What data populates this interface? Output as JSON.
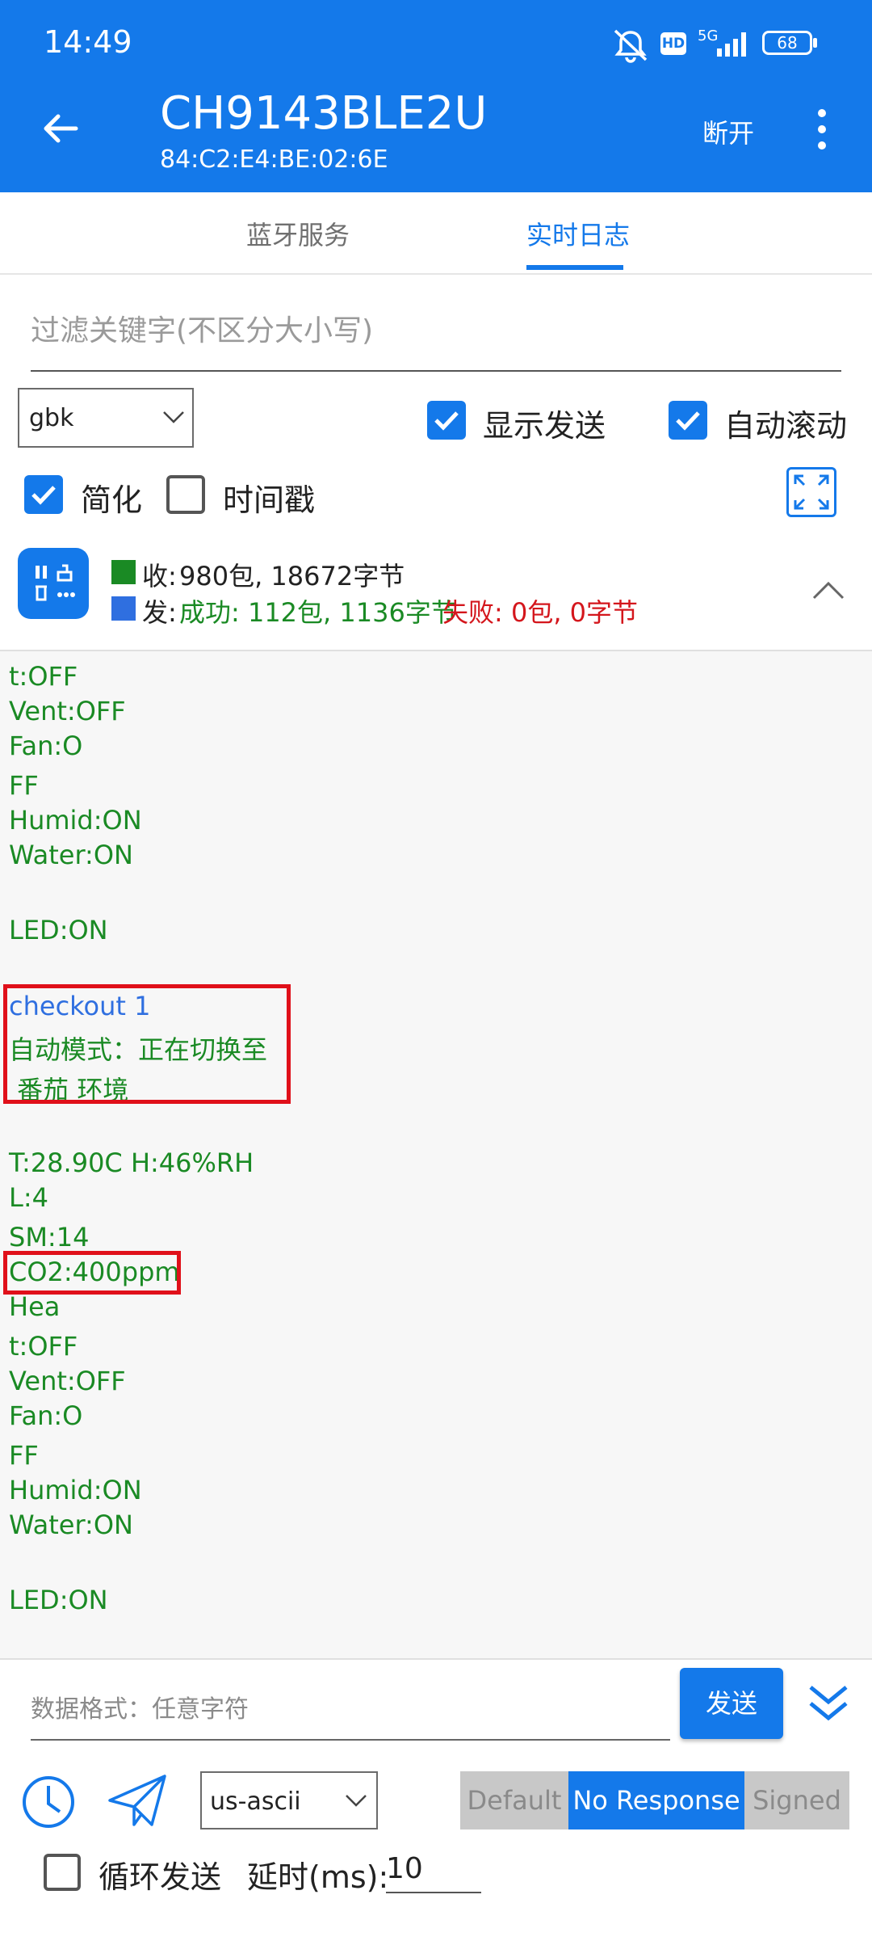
{
  "status_bar": {
    "time": "14:49",
    "network": "5G",
    "hd": "HD",
    "battery": "68"
  },
  "header": {
    "title": "CH9143BLE2U",
    "subtitle": "84:C2:E4:BE:02:6E",
    "disconnect_label": "断开"
  },
  "tabs": [
    {
      "label": "蓝牙服务",
      "active": false
    },
    {
      "label": "实时日志",
      "active": true
    }
  ],
  "filter": {
    "placeholder": "过滤关键字(不区分大小写)"
  },
  "options": {
    "charset": "gbk",
    "show_send": {
      "label": "显示发送",
      "checked": true
    },
    "auto_scroll": {
      "label": "自动滚动",
      "checked": true
    },
    "simplify": {
      "label": "简化",
      "checked": true
    },
    "timestamp": {
      "label": "时间戳",
      "checked": false
    }
  },
  "stats": {
    "recv_prefix": "收:",
    "recv_text": "980包, 18672字节",
    "send_prefix": "发:",
    "success_text": "成功: 112包, 1136字节",
    "fail_text": "失败: 0包, 0字节"
  },
  "log_lines": [
    "t:OFF",
    "Vent:OFF",
    "Fan:O",
    "FF",
    "Humid:ON",
    "Water:ON",
    "LED:ON",
    "checkout 1",
    "自动模式：正在切换至",
    " 番茄 环境",
    "T:28.90C H:46%RH",
    "L:4",
    "SM:14",
    "CO2:400ppm",
    "Hea",
    "t:OFF",
    "Vent:OFF",
    "Fan:O",
    "FF",
    "Humid:ON",
    "Water:ON",
    "LED:ON"
  ],
  "send": {
    "placeholder": "数据格式：任意字符",
    "button": "发送",
    "encoding": "us-ascii"
  },
  "write_types": [
    {
      "label": "Default",
      "selected": false
    },
    {
      "label": "No Response",
      "selected": true
    },
    {
      "label": "Signed",
      "selected": false
    }
  ],
  "loop": {
    "label": "循环发送",
    "checked": false,
    "delay_label": "延时(ms):",
    "delay_value": "10"
  },
  "colors": {
    "primary": "#1479ea",
    "log_green": "#1a8a24",
    "log_blue": "#2f6fe0",
    "fail_red": "#d4161c",
    "highlight_red": "#e0101a"
  }
}
